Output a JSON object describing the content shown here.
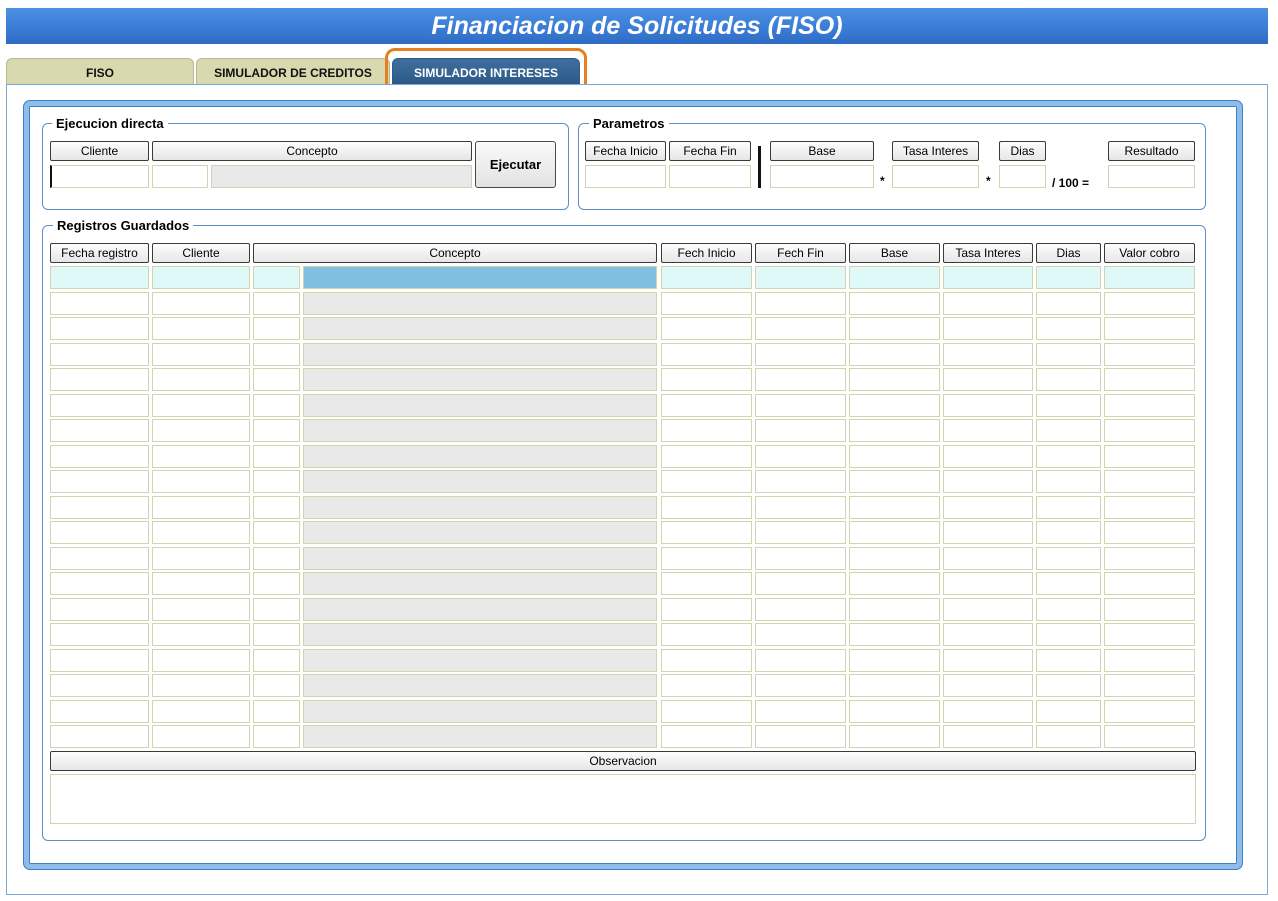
{
  "app": {
    "title": "Financiacion de Solicitudes (FISO)"
  },
  "tabs": [
    {
      "label": "FISO"
    },
    {
      "label": "SIMULADOR DE CREDITOS"
    },
    {
      "label": "SIMULADOR INTERESES",
      "active": true
    }
  ],
  "ejecucion": {
    "title": "Ejecucion directa",
    "cliente_label": "Cliente",
    "concepto_label": "Concepto",
    "button": "Ejecutar"
  },
  "parametros": {
    "title": "Parametros",
    "fecha_inicio_label": "Fecha Inicio",
    "fecha_fin_label": "Fecha Fin",
    "base_label": "Base",
    "tasa_label": "Tasa Interes",
    "dias_label": "Dias",
    "resultado_label": "Resultado",
    "op_mult": "*",
    "op_div": "/ 100 ="
  },
  "registros": {
    "title": "Registros Guardados",
    "columns": [
      "Fecha registro",
      "Cliente",
      "Concepto",
      "Fech Inicio",
      "Fech Fin",
      "Base",
      "Tasa Interes",
      "Dias",
      "Valor cobro"
    ],
    "row_count": 19,
    "observacion_label": "Observacion"
  },
  "colors": {
    "title_bar": "#3a7bd5",
    "selected_row": "#dff8f8",
    "highlight_ring": "#e67e22"
  }
}
